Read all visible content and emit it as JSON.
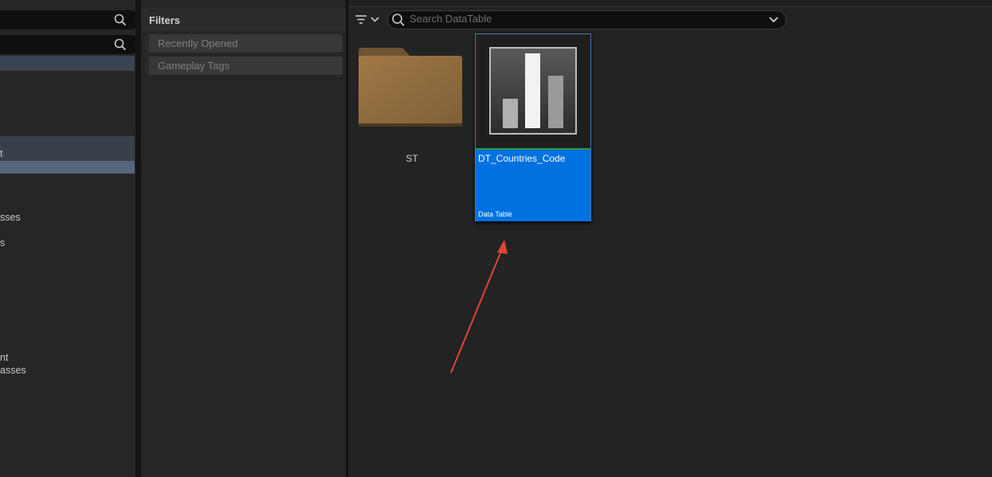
{
  "left_panel": {
    "tree_items": [
      "t",
      "sses",
      "s",
      "nt",
      "asses"
    ]
  },
  "filters": {
    "title": "Filters",
    "items": [
      {
        "label": "Recently Opened"
      },
      {
        "label": "Gameplay Tags"
      }
    ]
  },
  "content": {
    "search": {
      "placeholder": "Search DataTable"
    },
    "assets": [
      {
        "name": "ST",
        "type": "folder"
      },
      {
        "name": "DT_Countries_Code",
        "type_label": "Data Table"
      }
    ]
  },
  "colors": {
    "selection_blue": "#0071e0",
    "annotation_arrow": "#e0453a"
  }
}
